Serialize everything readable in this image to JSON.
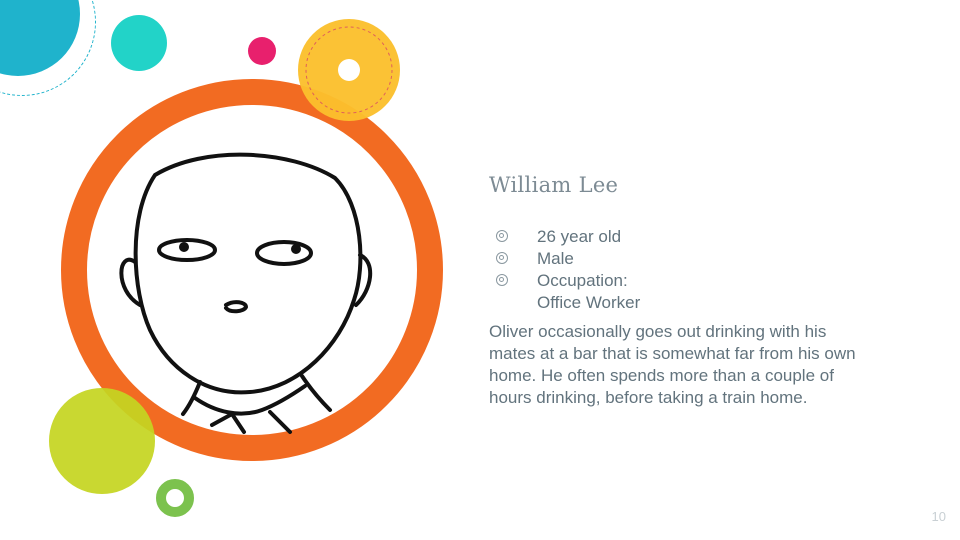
{
  "slide": {
    "title": "William Lee",
    "bullets": [
      {
        "icon": "circle-bullet-icon",
        "text": "26 year old"
      },
      {
        "icon": "circle-bullet-icon",
        "text": "Male"
      },
      {
        "icon": "circle-bullet-icon",
        "text": "Occupation:"
      },
      {
        "icon": "",
        "text": "Office Worker"
      }
    ],
    "description": "Oliver occasionally goes out drinking with his mates at a bar that is somewhat far from his own home. He often spends more than a couple of hours drinking, before taking a train home.",
    "page_number": "10"
  },
  "colors": {
    "ring": "#f26b22",
    "teal": "#1fb3cc",
    "turquoise": "#22d3c8",
    "pink": "#e8206d",
    "yellow": "#fbc02d",
    "lime": "#c5d521",
    "green": "#7cc24e",
    "text": "#62737d"
  }
}
